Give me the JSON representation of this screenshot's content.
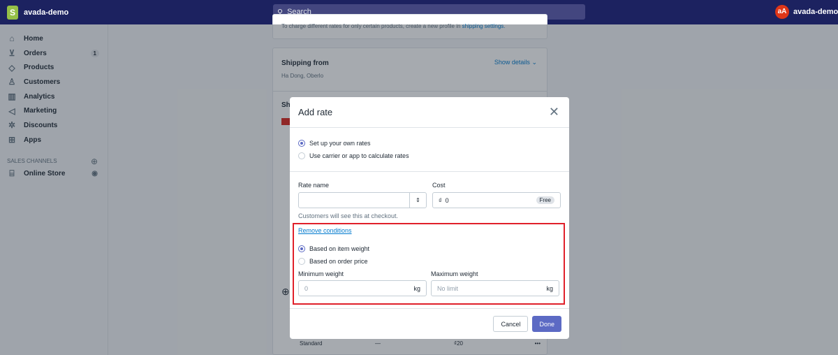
{
  "topbar": {
    "store": "avada-demo",
    "search_placeholder": "Search",
    "user_initials": "aA",
    "user_name": "avada-demo Admin"
  },
  "sidebar": {
    "items": [
      {
        "label": "Home",
        "icon": "home-icon"
      },
      {
        "label": "Orders",
        "icon": "orders-icon",
        "badge": "1"
      },
      {
        "label": "Products",
        "icon": "tag-icon"
      },
      {
        "label": "Customers",
        "icon": "person-icon"
      },
      {
        "label": "Analytics",
        "icon": "chart-icon"
      },
      {
        "label": "Marketing",
        "icon": "megaphone-icon"
      },
      {
        "label": "Discounts",
        "icon": "discount-icon"
      },
      {
        "label": "Apps",
        "icon": "apps-icon"
      }
    ],
    "sales_channels": "SALES CHANNELS",
    "online_store": "Online Store"
  },
  "background": {
    "note_text": "To charge different rates for only certain products, create a new profile in",
    "note_link": "shipping settings.",
    "shipping_from": "Shipping from",
    "show_details": "Show details",
    "location": "Ha Dong, Oberlo",
    "section_partial": "Sh",
    "rate_row": {
      "name": "Standard",
      "condition": "—",
      "price": "₫20"
    }
  },
  "modal": {
    "title": "Add rate",
    "options": [
      "Set up your own rates",
      "Use carrier or app to calculate rates"
    ],
    "rate_name_label": "Rate name",
    "rate_name_value": "",
    "cost_label": "Cost",
    "currency": "₫",
    "cost_value": "0",
    "free_badge": "Free",
    "help": "Customers will see this at checkout.",
    "remove_conditions": "Remove conditions",
    "conditions": [
      "Based on item weight",
      "Based on order price"
    ],
    "min_label": "Minimum weight",
    "min_placeholder": "0",
    "max_label": "Maximum weight",
    "max_placeholder": "No limit",
    "unit": "kg",
    "cancel": "Cancel",
    "done": "Done",
    "highlight_color": "#e0202a",
    "primary_color": "#5c6ac4"
  }
}
